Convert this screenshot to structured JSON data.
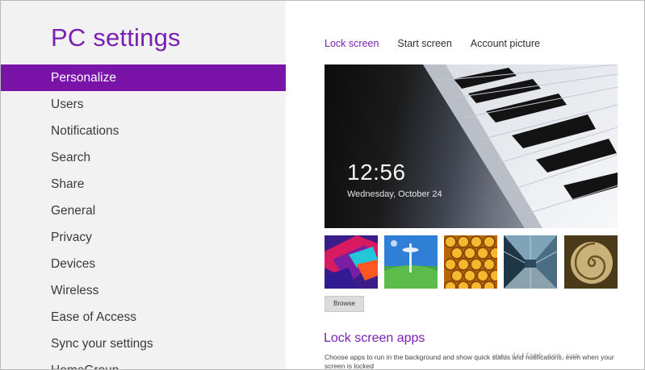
{
  "app": {
    "title": "PC settings"
  },
  "sidebar": {
    "items": [
      {
        "label": "Personalize",
        "active": true
      },
      {
        "label": "Users"
      },
      {
        "label": "Notifications"
      },
      {
        "label": "Search"
      },
      {
        "label": "Share"
      },
      {
        "label": "General"
      },
      {
        "label": "Privacy"
      },
      {
        "label": "Devices"
      },
      {
        "label": "Wireless"
      },
      {
        "label": "Ease of Access"
      },
      {
        "label": "Sync your settings"
      },
      {
        "label": "HomeGroup"
      }
    ]
  },
  "tabs": [
    {
      "label": "Lock screen",
      "active": true
    },
    {
      "label": "Start screen"
    },
    {
      "label": "Account picture"
    }
  ],
  "lockscreen_preview": {
    "time": "12:56",
    "date": "Wednesday, October 24"
  },
  "thumbnails": [
    {
      "name": "abstract-colors"
    },
    {
      "name": "space-needle"
    },
    {
      "name": "honeycomb"
    },
    {
      "name": "glass-building"
    },
    {
      "name": "nautilus-shell"
    }
  ],
  "browse_label": "Browse",
  "lock_screen_apps": {
    "title": "Lock screen apps",
    "description": "Choose apps to run in the background and show quick status and notifications, even when your screen is locked"
  },
  "watermark": "www.dr4ftbb.com.com",
  "colors": {
    "accent": "#7a14a8",
    "sidebar_bg": "#f2f2f2"
  }
}
